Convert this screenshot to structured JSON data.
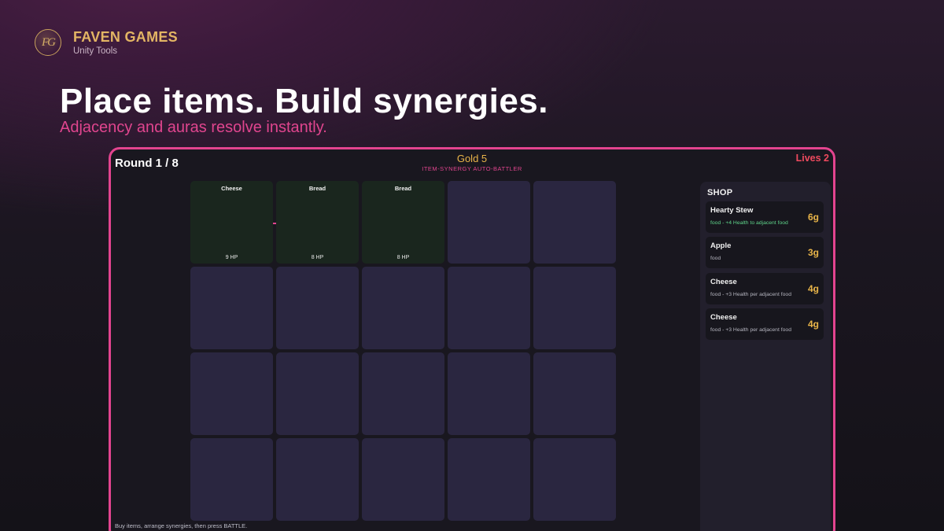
{
  "brand": {
    "logo_text": "FG",
    "name": "FAVEN GAMES",
    "subtitle": "Unity Tools"
  },
  "hero": {
    "headline": "Place items. Build synergies.",
    "subline": "Adjacency and auras resolve instantly."
  },
  "game": {
    "round": "Round 1 / 8",
    "gold": "Gold 5",
    "subtitle": "ITEM-SYNERGY AUTO-BATTLER",
    "lives": "Lives 2",
    "hint": "Buy items, arrange synergies, then press BATTLE.",
    "board": [
      {
        "name": "Cheese",
        "hp": "9 HP"
      },
      {
        "name": "Bread",
        "hp": "8 HP"
      },
      {
        "name": "Bread",
        "hp": "8 HP"
      }
    ]
  },
  "shop": {
    "title": "SHOP",
    "items": [
      {
        "name": "Hearty Stew",
        "desc": "food - +4 Health to adjacent food",
        "price": "6g"
      },
      {
        "name": "Apple",
        "desc": "food",
        "price": "3g"
      },
      {
        "name": "Cheese",
        "desc": "food - +3 Health per adjacent food",
        "price": "4g"
      },
      {
        "name": "Cheese",
        "desc": "food - +3 Health per adjacent food",
        "price": "4g"
      }
    ]
  },
  "colors": {
    "accent": "#e3448f",
    "gold": "#e9b549",
    "lives": "#ef4a5e",
    "synergy_text": "#5fd48a"
  }
}
